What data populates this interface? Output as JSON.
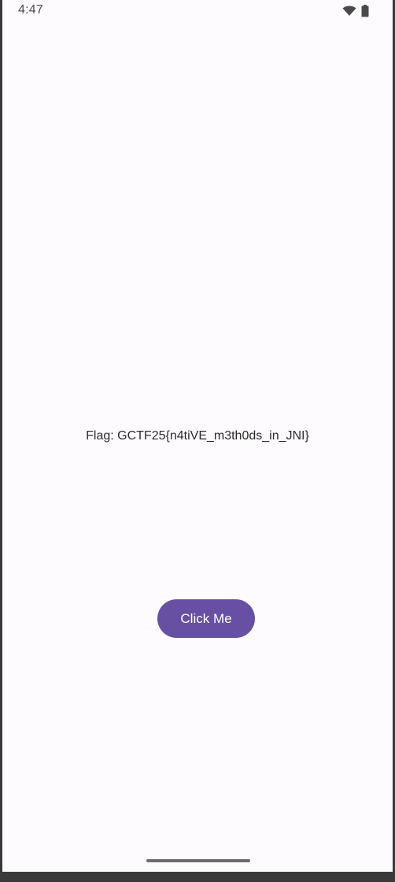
{
  "status_bar": {
    "time": "4:47",
    "icons": [
      "wifi-icon",
      "battery-icon"
    ]
  },
  "main": {
    "flag_text": "Flag: GCTF25{n4tiVE_m3th0ds_in_JNI}",
    "button_label": "Click Me"
  },
  "colors": {
    "background": "#fefbff",
    "button": "#6750a4",
    "button_text": "#ffffff"
  }
}
